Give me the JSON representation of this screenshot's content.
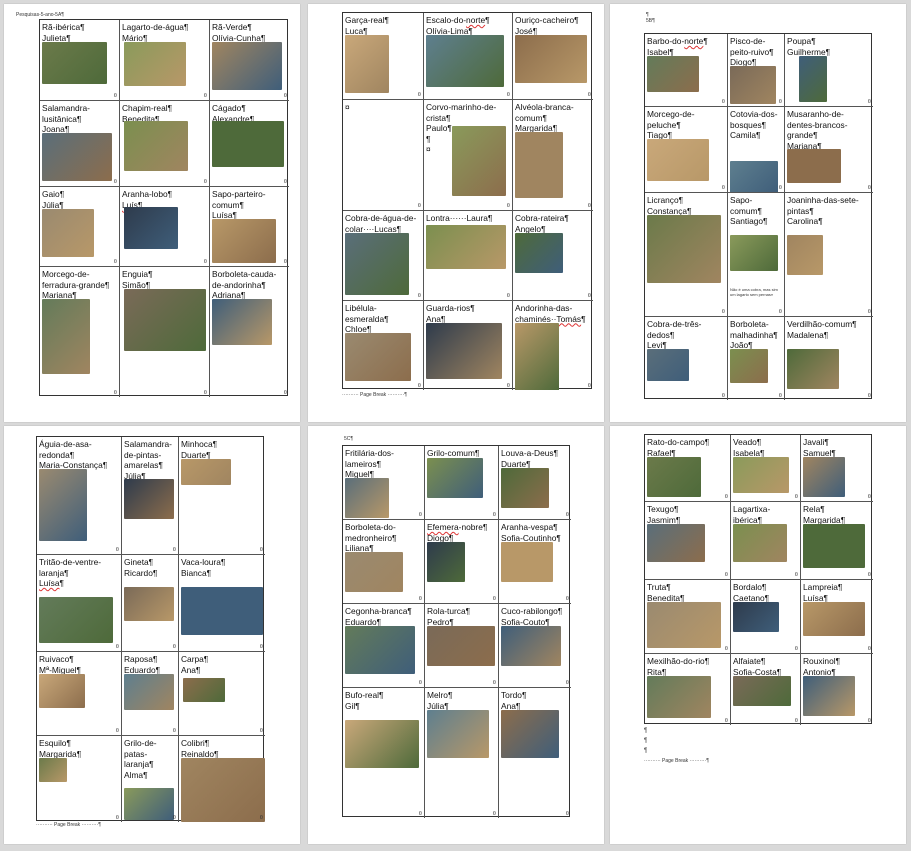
{
  "pages": [
    {
      "header": "Pesquisas-5-ano-5A¶",
      "cells": [
        "Rã-ibérica¶\nJulieta¶",
        "Lagarto-de-água¶\nMário¶",
        "Rã-Verde¶\nOlívia-Cunha¶",
        "Salamandra-lusitânica¶\nJoana¶",
        "Chapim-real¶\nBenedita¶",
        "Cágado¶\nAlexandre¶",
        "Gaio¶\nJúlia¶",
        "Aranha-lobo¶\nLuís¶",
        "Sapo-parteiro-comum¶\nLuísa¶",
        "Morcego-de-ferradura-grande¶\nMariana¶",
        "Enguia¶\nSimão¶",
        "Borboleta-cauda-de-andorinha¶\nAdriana¶"
      ]
    },
    {
      "header": "",
      "cells": [
        "Garça-real¶\nLuca¶",
        "Escalo-do-norte¶\nOlívia-Lima¶",
        "Ouriço-cacheiro¶\nJosé¶",
        "¤",
        "Corvo-marinho-de-crista¶\nPaulo¶\n¶\n¤",
        "Alvéola-branca-comum¶\nMargarida¶",
        "Cobra-de-água-de-colar····Lucas¶",
        "Lontra······Laura¶",
        "Cobra-rateira¶\nAngelo¶",
        "Libélula-esmeralda¶\nChloe¶",
        "Guarda-rios¶\nAna¶",
        "Andorinha-das-chaminés··Tomás¶"
      ],
      "page_break": "·········· Page Break ··········¶"
    },
    {
      "header": "¶\n5B¶",
      "cells": [
        "Barbo-do-norte¶\nIsabel¶",
        "Pisco-de-peito-ruivo¶\nDiogo¶",
        "Poupa¶\nGuilherme¶",
        "Morcego-de-peluche¶\nTiago¶",
        "Cotovia-dos-bosques¶\nCamila¶",
        "Musaranho-de-dentes-brancos-grande¶\nMariana¶",
        "Licranço¶\nConstança¶",
        "Sapo-comum¶\nSantiago¶",
        "Joaninha-das-sete-pintas¶\nCarolina¶",
        "Cobra-de-três-dedos¶\nLevi¶",
        "Borboleta-malhadinha¶\nJoão¶",
        "Verdilhão-comum¶\nMadalena¶"
      ],
      "note": "Não é uma cobra, mas sim um lagarto sem pernas¤"
    },
    {
      "header": "",
      "cells": [
        "Águia-de-asa-redonda¶\nMaria-Constança¶",
        "Salamandra-de-pintas-amarelas¶\nJúlia¶",
        "Minhoca¶\nDuarte¶",
        "Tritão-de-ventre-laranja¶\nLuísa¶",
        "Gineta¶\nRicardo¶",
        "Vaca-loura¶\nBianca¶",
        "Ruivaco¶\nMª-Miguel¶",
        "Raposa¶\nEduardo¶",
        "Carpa¶\nAna¶",
        "Esquilo¶\nMargarida¶",
        "Grilo-de-patas-laranja¶\nAlma¶",
        "Colibri¶\nReinaldo¶"
      ],
      "page_break": "·········· Page Break ··········¶"
    },
    {
      "header": "5C¶",
      "cells": [
        "Fritilária-dos-lameiros¶\nMiguel¶",
        "Grilo-comum¶\nInês¶",
        "Louva-a-Deus¶\nDuarte¶",
        "Borboleta-do-medronheiro¶\nLiliana¶",
        "Efemera-nobre¶\nDiogo¶",
        "Aranha-vespa¶\nSofia-Coutinho¶",
        "Cegonha-branca¶\nEduardo¶",
        "Rola-turca¶\nPedro¶",
        "Cuco-rabilongo¶\nSofia-Couto¶",
        "Bufo-real¶\nGil¶",
        "Melro¶\nJúlia¶",
        "Tordo¶\nAna¶"
      ]
    },
    {
      "header": "",
      "cells": [
        "Rato-do-campo¶\nRafael¶",
        "Veado¶\nIsabela¶",
        "Javali¶\nSamuel¶",
        "Texugo¶\nJasmim¶",
        "Lagartixa-ibérica¶\nLeonor¶",
        "Rela¶\nMargarida¶",
        "Truta¶\nBenedita¶",
        "Bordalo¶\nCaetano¶",
        "Lampreia¶\nLuísa¶",
        "Mexilhão-do-rio¶\nRita¶",
        "Alfaiate¶\nSofia-Costa¶",
        "Rouxinol¶\nAntonio¶"
      ],
      "page_break": "·········· Page Break ··········¶",
      "trailing_marks": "¶\n¶\n¶"
    }
  ],
  "colors": {
    "photo_palette": [
      "#6b7a4a",
      "#8a9a5b",
      "#a08560",
      "#5a6e7a",
      "#7b8f4f",
      "#4e6a3a",
      "#9a8a70",
      "#2e3b4c",
      "#b89868",
      "#637b5a",
      "#7a6a58",
      "#3f5e7a",
      "#c9a87a",
      "#5e7f8f",
      "#8c6d4c"
    ]
  }
}
